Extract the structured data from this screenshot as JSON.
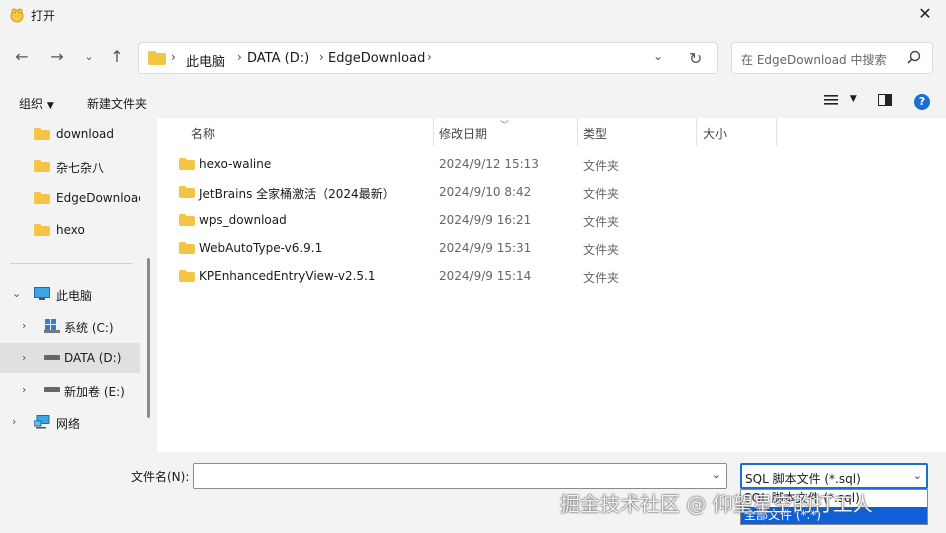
{
  "window": {
    "title": "打开"
  },
  "address": {
    "crumbs": [
      "此电脑",
      "DATA (D:)",
      "EdgeDownload"
    ],
    "search_placeholder": "在 EdgeDownload 中搜索"
  },
  "toolbar": {
    "organize": "组织",
    "new_folder": "新建文件夹"
  },
  "sidebar": {
    "quick": [
      "download",
      "杂七杂八",
      "EdgeDownload",
      "hexo"
    ],
    "this_pc": "此电脑",
    "drives": [
      "系统 (C:)",
      "DATA (D:)",
      "新加卷 (E:)"
    ],
    "network": "网络"
  },
  "columns": {
    "name": "名称",
    "modified": "修改日期",
    "type": "类型",
    "size": "大小"
  },
  "files": [
    {
      "name": "hexo-waline",
      "modified": "2024/9/12 15:13",
      "type": "文件夹"
    },
    {
      "name": "JetBrains 全家桶激活（2024最新）",
      "modified": "2024/9/10 8:42",
      "type": "文件夹"
    },
    {
      "name": "wps_download",
      "modified": "2024/9/9 16:21",
      "type": "文件夹"
    },
    {
      "name": "WebAutoType-v6.9.1",
      "modified": "2024/9/9 15:31",
      "type": "文件夹"
    },
    {
      "name": "KPEnhancedEntryView-v2.5.1",
      "modified": "2024/9/9 15:14",
      "type": "文件夹"
    }
  ],
  "bottom": {
    "filename_label": "文件名(N):",
    "filename_value": "",
    "filetype_selected": "SQL 脚本文件 (*.sql)",
    "filetype_options": [
      "SQL 脚本文件 (*.sql)",
      "全部文件 (*.*)"
    ],
    "watermark": "掘金技术社区 @ 仰望星空的打工人"
  },
  "colors": {
    "accent": "#1a6fd1",
    "folder": "#f4c542",
    "selection": "#0f5fd6"
  }
}
